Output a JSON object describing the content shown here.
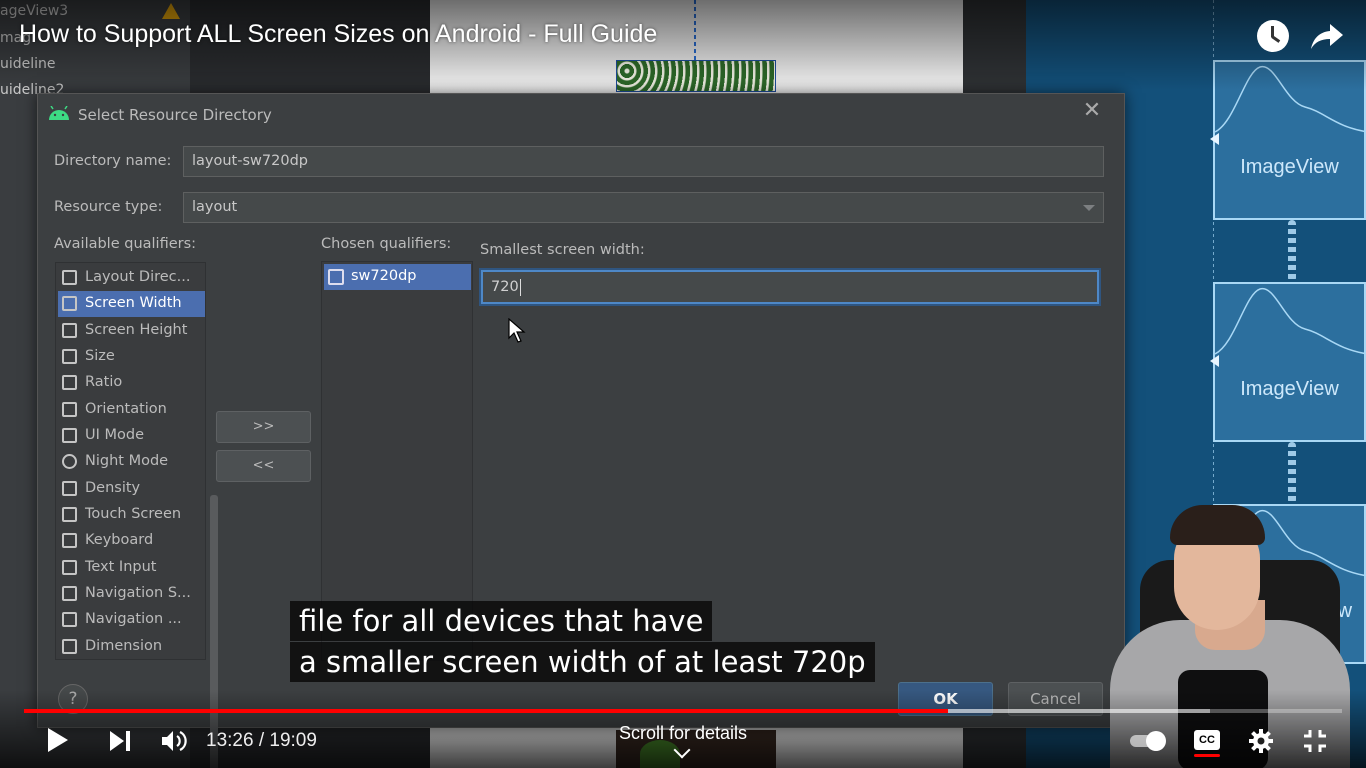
{
  "player": {
    "video_title": "How to Support ALL Screen Sizes on Android - Full Guide",
    "time_current": "13:26",
    "time_total": "19:09",
    "time_display": "13:26 / 19:09",
    "progress_fraction": 0.7011,
    "buffer_fraction": 0.9,
    "scroll_hint": "Scroll for details",
    "cc_label": "CC",
    "accent_color": "#ff0000",
    "icons": [
      "watch-later-icon",
      "share-icon",
      "play-icon",
      "next-icon",
      "volume-icon",
      "autoplay-toggle-icon",
      "captions-icon",
      "settings-gear-icon",
      "exit-fullscreen-icon"
    ]
  },
  "captions": {
    "line1": "file for all devices that have",
    "line2": "a smaller screen width of at least 720p"
  },
  "ide_background": {
    "tree_items": [
      "ageView3",
      "mag",
      "uideline",
      "uideline2"
    ],
    "blueprint_labels": [
      "ImageView",
      "ImageView",
      "geView"
    ]
  },
  "dialog": {
    "title": "Select Resource Directory",
    "directory_name_label": "Directory name:",
    "directory_name_value": "layout-sw720dp",
    "resource_type_label": "Resource type:",
    "resource_type_value": "layout",
    "available_label": "Available qualifiers:",
    "chosen_label": "Chosen qualifiers:",
    "available_qualifiers": [
      {
        "label": "Layout Direc...",
        "icon": "layout-direction-icon"
      },
      {
        "label": "Screen Width",
        "icon": "screen-width-icon",
        "selected": true
      },
      {
        "label": "Screen Height",
        "icon": "screen-height-icon"
      },
      {
        "label": "Size",
        "icon": "size-icon"
      },
      {
        "label": "Ratio",
        "icon": "ratio-icon"
      },
      {
        "label": "Orientation",
        "icon": "orientation-icon"
      },
      {
        "label": "UI Mode",
        "icon": "ui-mode-icon"
      },
      {
        "label": "Night Mode",
        "icon": "night-mode-icon"
      },
      {
        "label": "Density",
        "icon": "density-icon"
      },
      {
        "label": "Touch Screen",
        "icon": "touch-screen-icon"
      },
      {
        "label": "Keyboard",
        "icon": "keyboard-icon"
      },
      {
        "label": "Text Input",
        "icon": "text-input-icon"
      },
      {
        "label": "Navigation S...",
        "icon": "navigation-state-icon"
      },
      {
        "label": "Navigation ...",
        "icon": "navigation-method-icon"
      },
      {
        "label": "Dimension",
        "icon": "dimension-icon"
      }
    ],
    "chosen_qualifiers": [
      {
        "label": "sw720dp",
        "icon": "screen-width-icon"
      }
    ],
    "add_button": ">>",
    "remove_button": "<<",
    "detail_label": "Smallest screen width:",
    "detail_value": "720",
    "help_button": "?",
    "ok_button": "OK",
    "cancel_button": "Cancel",
    "close_glyph": "✕"
  }
}
